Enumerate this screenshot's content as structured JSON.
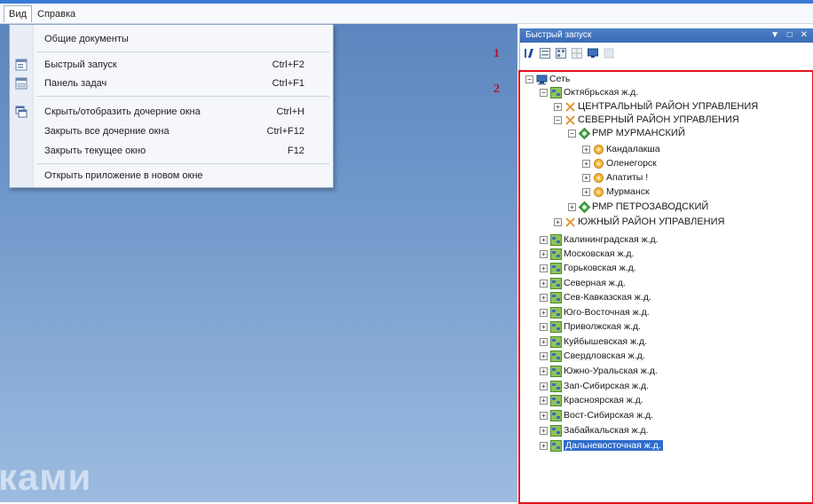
{
  "menubar": {
    "items": [
      {
        "label": "Вид"
      },
      {
        "label": "Справка"
      }
    ]
  },
  "workspace": {
    "watermark": "ками"
  },
  "dropdown": {
    "items": [
      {
        "label": "Общие документы",
        "shortcut": ""
      },
      {
        "label": "Быстрый запуск",
        "shortcut": "Ctrl+F2",
        "icon": "quick-launch-icon"
      },
      {
        "label": "Панель задач",
        "shortcut": "Ctrl+F1",
        "icon": "taskbar-icon"
      },
      {
        "label": "Скрыть/отобразить дочерние окна",
        "shortcut": "Ctrl+H",
        "icon": "windows-icon"
      },
      {
        "label": "Закрыть все дочерние окна",
        "shortcut": "Ctrl+F12"
      },
      {
        "label": "Закрыть текущее окно",
        "shortcut": "F12"
      },
      {
        "label": "Открыть приложение в новом окне",
        "shortcut": ""
      }
    ]
  },
  "annotations": {
    "one": "1",
    "two": "2"
  },
  "panel": {
    "title": "Быстрый запуск",
    "title_buttons": "▼ □ ✕"
  },
  "tree": {
    "nodes": [
      {
        "label": "Сеть",
        "expander": "⊟"
      },
      {
        "label": "Октябрьская ж.д.",
        "expander": "⊟"
      },
      {
        "label": "ЦЕНТРАЛЬНЫЙ РАЙОН УПРАВЛЕНИЯ",
        "expander": "⊞"
      },
      {
        "label": "СЕВЕРНЫЙ РАЙОН УПРАВЛЕНИЯ",
        "expander": "⊟"
      },
      {
        "label": "РМР МУРМАНСКИЙ",
        "expander": "⊟"
      },
      {
        "label": "Кандалакша",
        "expander": "⊞"
      },
      {
        "label": "Оленегорск",
        "expander": "⊞"
      },
      {
        "label": "Апатиты !",
        "expander": "⊞"
      },
      {
        "label": "Мурманск",
        "expander": "⊞"
      },
      {
        "label": "РМР ПЕТРОЗАВОДСКИЙ",
        "expander": "⊞"
      },
      {
        "label": "ЮЖНЫЙ РАЙОН УПРАВЛЕНИЯ",
        "expander": "⊞"
      },
      {
        "label": "Калининградская ж.д.",
        "expander": "⊞"
      },
      {
        "label": "Московская ж.д.",
        "expander": "⊞"
      },
      {
        "label": "Горьковская ж.д.",
        "expander": "⊞"
      },
      {
        "label": "Северная ж.д.",
        "expander": "⊞"
      },
      {
        "label": "Сев-Кавказская ж.д.",
        "expander": "⊞"
      },
      {
        "label": "Юго-Восточная ж.д.",
        "expander": "⊞"
      },
      {
        "label": "Приволжская ж.д.",
        "expander": "⊞"
      },
      {
        "label": "Куйбышевская ж.д.",
        "expander": "⊞"
      },
      {
        "label": "Свердловская ж.д.",
        "expander": "⊞"
      },
      {
        "label": "Южно-Уральская ж.д.",
        "expander": "⊞"
      },
      {
        "label": "Зап-Сибирская ж.д.",
        "expander": "⊞"
      },
      {
        "label": "Красноярская ж.д.",
        "expander": "⊞"
      },
      {
        "label": "Вост-Сибирская ж.д.",
        "expander": "⊞"
      },
      {
        "label": "Забайкальская ж.д.",
        "expander": "⊞"
      },
      {
        "label": "Дальневосточная ж.д.",
        "expander": "⊞"
      }
    ],
    "selected_label": "Дальневосточная ж.д."
  },
  "colors": {
    "accent": "#3c7ad6",
    "highlight_border": "#e3121f",
    "annotation": "#c0122a",
    "selection": "#2f6ccc"
  }
}
